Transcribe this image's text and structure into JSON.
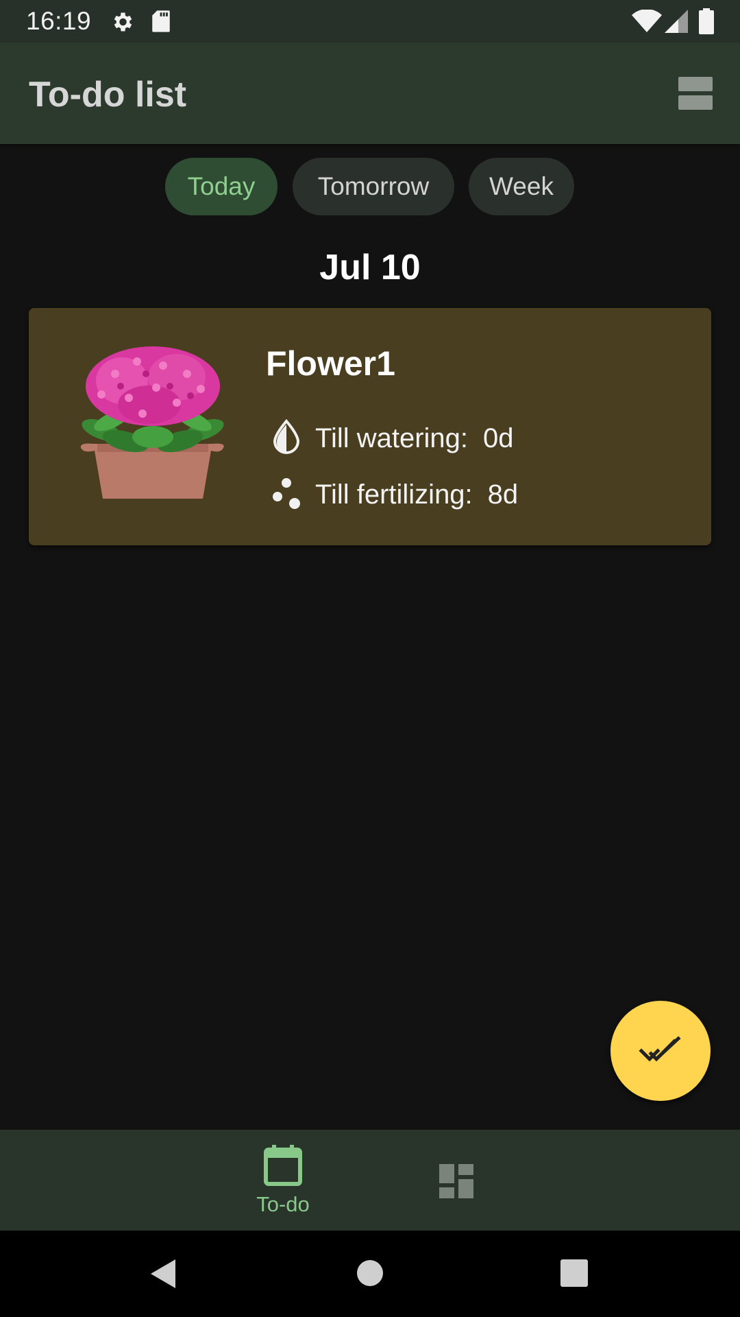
{
  "status_bar": {
    "time": "16:19",
    "icons": [
      "gear-icon",
      "sd-card-icon",
      "wifi-icon",
      "cellular-signal-icon",
      "battery-icon"
    ]
  },
  "app_bar": {
    "title": "To-do list",
    "action_icon": "view-toggle-icon"
  },
  "filters": {
    "chips": [
      {
        "label": "Today",
        "selected": true
      },
      {
        "label": "Tomorrow",
        "selected": false
      },
      {
        "label": "Week",
        "selected": false
      }
    ]
  },
  "date_header": "Jul 10",
  "tasks": [
    {
      "name": "Flower1",
      "image": "flower-pot-illustration",
      "watering_label": "Till watering:",
      "watering_value": "0d",
      "fertilizing_label": "Till fertilizing:",
      "fertilizing_value": "8d"
    }
  ],
  "fab": {
    "icon": "double-check-icon"
  },
  "bottom_nav": {
    "items": [
      {
        "icon": "calendar-icon",
        "label": "To-do",
        "selected": true
      },
      {
        "icon": "dashboard-icon",
        "label": "",
        "selected": false
      }
    ]
  },
  "system_nav": [
    "back-icon",
    "home-icon",
    "recents-icon"
  ],
  "colors": {
    "background": "#121212",
    "app_bar": "#2c3a2e",
    "chip_selected_bg": "#2f4d33",
    "chip_selected_text": "#8fcf8f",
    "card": "#4a3e20",
    "fab": "#ffd54f",
    "bottom_nav": "#29352a"
  }
}
